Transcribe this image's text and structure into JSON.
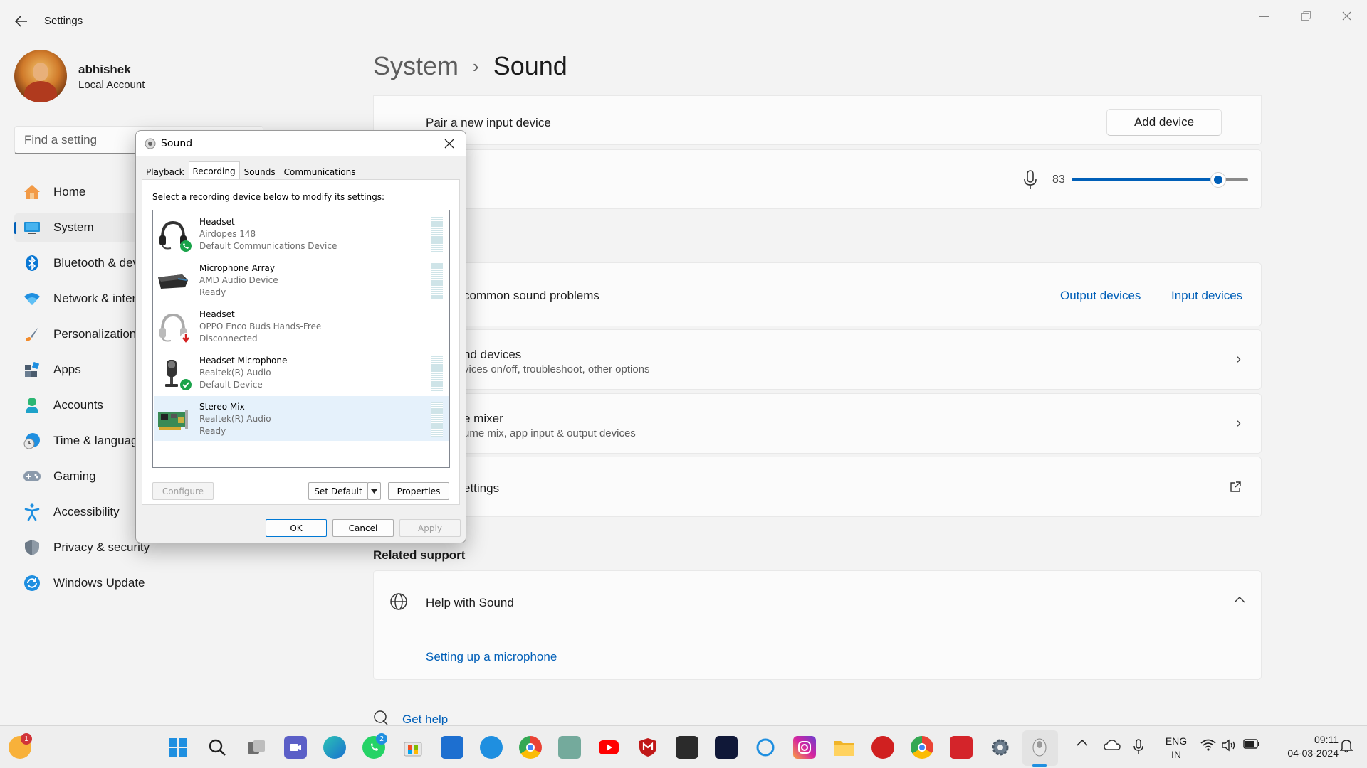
{
  "window": {
    "title": "Settings"
  },
  "profile": {
    "name": "abhishek",
    "account_type": "Local Account"
  },
  "search": {
    "placeholder": "Find a setting"
  },
  "nav": [
    {
      "label": "Home",
      "icon": "home-icon"
    },
    {
      "label": "System",
      "icon": "system-icon",
      "active": true
    },
    {
      "label": "Bluetooth & devices",
      "icon": "bluetooth-icon"
    },
    {
      "label": "Network & internet",
      "icon": "network-icon"
    },
    {
      "label": "Personalization",
      "icon": "brush-icon"
    },
    {
      "label": "Apps",
      "icon": "apps-icon"
    },
    {
      "label": "Accounts",
      "icon": "accounts-icon"
    },
    {
      "label": "Time & language",
      "icon": "time-language-icon"
    },
    {
      "label": "Gaming",
      "icon": "gaming-icon"
    },
    {
      "label": "Accessibility",
      "icon": "accessibility-icon"
    },
    {
      "label": "Privacy & security",
      "icon": "shield-icon"
    },
    {
      "label": "Windows Update",
      "icon": "update-icon"
    }
  ],
  "breadcrumb": {
    "parent": "System",
    "current": "Sound"
  },
  "main": {
    "pair": {
      "label": "Pair a new input device",
      "button": "Add device"
    },
    "volume": {
      "value": "83",
      "level": 0.83
    },
    "troubleshoot": {
      "label": "common sound problems",
      "output_link": "Output devices",
      "input_link": "Input devices"
    },
    "all_devices": {
      "title": "nd devices",
      "subtitle": "vices on/off, troubleshoot, other options"
    },
    "mixer": {
      "title": "e mixer",
      "subtitle": "ume mix, app input & output devices"
    },
    "more": {
      "title": "ettings"
    },
    "related_support": "Related support",
    "help": {
      "title": "Help with Sound",
      "link": "Setting up a microphone"
    },
    "get_help": "Get help"
  },
  "dialog": {
    "title": "Sound",
    "tabs": [
      "Playback",
      "Recording",
      "Sounds",
      "Communications"
    ],
    "selected_tab": "Recording",
    "instruction": "Select a recording device below to modify its settings:",
    "devices": [
      {
        "name": "Headset",
        "line2": "Airdopes 148",
        "line3": "Default Communications Device",
        "icon": "headset-icon",
        "status": "phone-badge-icon"
      },
      {
        "name": "Microphone Array",
        "line2": "AMD Audio Device",
        "line3": "Ready",
        "icon": "microphone-array-icon"
      },
      {
        "name": "Headset",
        "line2": "OPPO Enco Buds Hands-Free",
        "line3": "Disconnected",
        "icon": "headset-icon",
        "status": "disconnected-badge-icon"
      },
      {
        "name": "Headset Microphone",
        "line2": "Realtek(R) Audio",
        "line3": "Default Device",
        "icon": "headset-microphone-icon",
        "status": "check-badge-icon"
      },
      {
        "name": "Stereo Mix",
        "line2": "Realtek(R) Audio",
        "line3": "Ready",
        "icon": "sound-card-icon",
        "selected": true
      }
    ],
    "buttons": {
      "configure": "Configure",
      "set_default": "Set Default",
      "properties": "Properties",
      "ok": "OK",
      "cancel": "Cancel",
      "apply": "Apply"
    }
  },
  "taskbar": {
    "start_badge": "1",
    "whatsapp_badge": "2",
    "apps": [
      "start-icon",
      "search-icon",
      "task-view-icon",
      "teams-icon",
      "edge-icon",
      "whatsapp-icon",
      "store-icon",
      "myhp-icon",
      "tips-icon",
      "chrome-icon",
      "chatgpt-icon",
      "youtube-icon",
      "mcafee-icon",
      "typora-icon",
      "dh-icon",
      "cortana-icon",
      "instagram-icon",
      "file-explorer-icon",
      "tuf-icon",
      "chrome-profile-icon",
      "acrobat-icon",
      "settings-icon",
      "sound-icon"
    ],
    "lang_1": "ENG",
    "lang_2": "IN",
    "time": "09:11",
    "date": "04-03-2024"
  },
  "colors": {
    "accent": "#005fb8",
    "background": "#f3f3f3",
    "card": "#fbfbfb"
  }
}
